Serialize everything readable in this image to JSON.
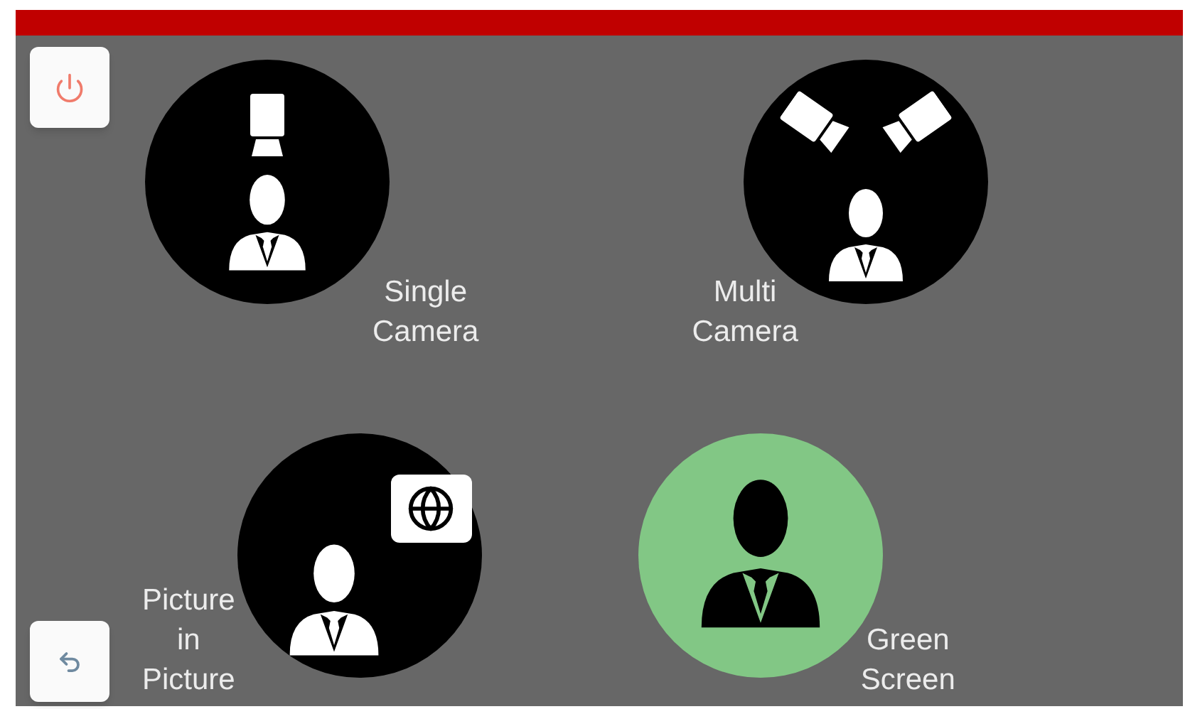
{
  "modes": [
    {
      "label": "Single Camera",
      "kind": "single-camera",
      "selected": false
    },
    {
      "label": "Multi Camera",
      "kind": "multi-camera",
      "selected": false
    },
    {
      "label": "Picture in Picture",
      "kind": "picture-in-picture",
      "selected": false
    },
    {
      "label": "Green Screen",
      "kind": "green-screen",
      "selected": true
    }
  ]
}
